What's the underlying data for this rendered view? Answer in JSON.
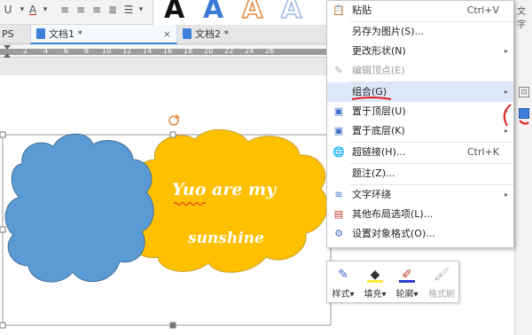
{
  "toolbar": {
    "text_style_labels": [
      "A",
      "A",
      "A",
      "A"
    ],
    "text_style_colors": [
      "#111111",
      "#3a7bd5",
      "#e8873a",
      "#9bb7e6"
    ],
    "right_label": "文字"
  },
  "tabs": [
    {
      "label": "PS",
      "active": false
    },
    {
      "label": "文档1 *",
      "active": true,
      "close": "×"
    },
    {
      "label": "文档2 *",
      "active": false,
      "close": "×"
    }
  ],
  "ruler": {
    "numbers": [
      "2",
      "4",
      "6",
      "8",
      "10",
      "12",
      "14",
      "16",
      "18",
      "20",
      "22",
      "24",
      "26"
    ]
  },
  "shape_text": {
    "line1": "Yuo are my",
    "line2": "sunshine"
  },
  "colors": {
    "blue_cloud": "#5b9bd5",
    "yellow_cloud": "#ffc000",
    "menu_highlight": "#dce8f7",
    "annotation_red": "#e02020"
  },
  "menu": {
    "items": [
      {
        "icon": "paste-icon",
        "label": "粘贴",
        "shortcut": "Ctrl+V"
      },
      {
        "icon": "",
        "label": "另存为图片(S)..."
      },
      {
        "icon": "",
        "label": "更改形状(N)",
        "submenu": "▸"
      },
      {
        "icon": "edit-points-icon",
        "label": "编辑顶点(E)",
        "disabled": true
      },
      {
        "icon": "",
        "label": "组合(G)",
        "submenu": "▸",
        "highlighted": true
      },
      {
        "icon": "bring-to-front-icon",
        "label": "置于顶层(U)",
        "submenu": "▸"
      },
      {
        "icon": "send-to-back-icon",
        "label": "置于底层(K)",
        "submenu": "▸"
      },
      {
        "icon": "hyperlink-icon",
        "label": "超链接(H)...",
        "shortcut": "Ctrl+K"
      },
      {
        "icon": "",
        "label": "题注(Z)..."
      },
      {
        "icon": "text-wrap-icon",
        "label": "文字环绕",
        "submenu": "▸"
      },
      {
        "icon": "layout-options-icon",
        "label": "其他布局选项(L)..."
      },
      {
        "icon": "format-object-icon",
        "label": "设置对象格式(O)..."
      }
    ]
  },
  "float_toolbar": {
    "buttons": [
      {
        "label": "样式",
        "arrow": "▾"
      },
      {
        "label": "填充",
        "arrow": "▾"
      },
      {
        "label": "轮廓",
        "arrow": "▾"
      },
      {
        "label": "格式刷",
        "disabled": true
      }
    ]
  }
}
